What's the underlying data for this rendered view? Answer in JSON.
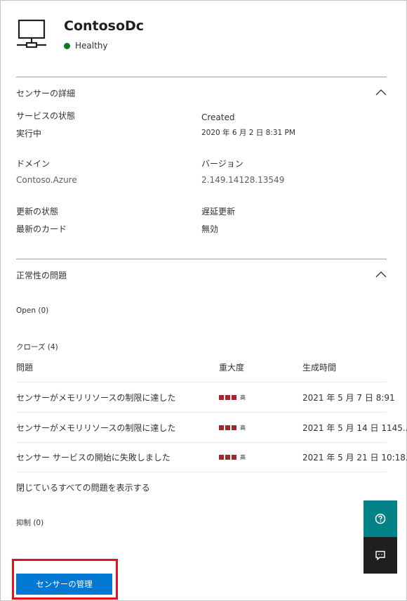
{
  "header": {
    "icon": "computer-network-icon",
    "title": "ContosoDc",
    "status": "Healthy",
    "status_color": "#107c10"
  },
  "sensor_details": {
    "title": "センサーの詳細",
    "fields": {
      "service_state_label": "サービスの状態",
      "service_state_value": "実行中",
      "created_label": "Created",
      "created_value": "2020 年 6 月 2 日 8:31 PM",
      "domain_label": "ドメイン",
      "domain_value": "Contoso.Azure",
      "version_label": "バージョン",
      "version_value": "2.149.14128.13549",
      "update_status_label": "更新の状態",
      "update_status_value": "最新のカード",
      "delayed_update_label": "遅延更新",
      "delayed_update_value": "無効"
    }
  },
  "health_issues": {
    "title": "正常性の問題",
    "open_label": "Open (0)",
    "closed_label": "クローズ (4)",
    "columns": [
      "問題",
      "重大度",
      "生成時間"
    ],
    "rows": [
      {
        "issue": "センサーがメモリリソースの制限に達した",
        "severity": "高",
        "time": "2021 年 5 月 7 日 8:91"
      },
      {
        "issue": "センサーがメモリリソースの制限に達した",
        "severity": "高",
        "time": "2021 年 5 月 14 日 1145..."
      },
      {
        "issue": "センサー サービスの開始に失敗しました",
        "severity": "高",
        "time": "2021 年 5 月 21 日 10:18..."
      }
    ],
    "view_all": "閉じているすべての問題を表示する",
    "suppressed_label": "抑制 (0)"
  },
  "actions": {
    "manage_sensor": "センサーの管理"
  },
  "colors": {
    "accent": "#0078d4",
    "severity_high": "#a4262c",
    "help_bg": "#038387",
    "highlight": "#e3121b"
  }
}
